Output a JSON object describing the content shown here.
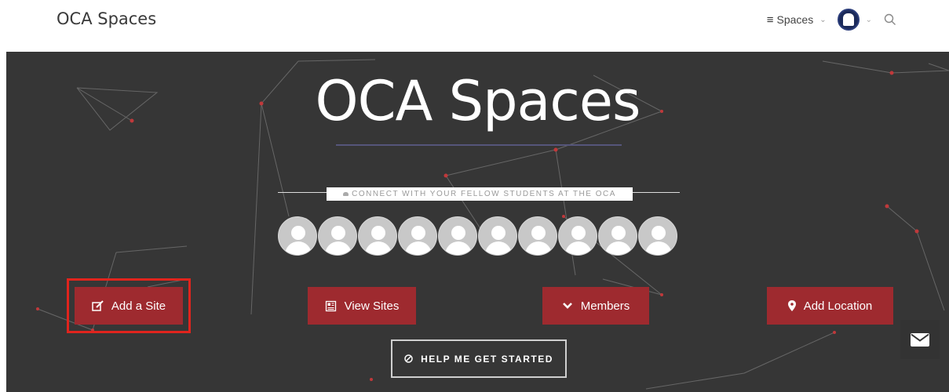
{
  "site": {
    "brand": "OCA Spaces"
  },
  "nav": {
    "spaces_label": "Spaces"
  },
  "hero": {
    "title": "OCA Spaces",
    "tagline": "CONNECT WITH YOUR FELLOW STUDENTS AT THE OCA",
    "member_count": 10
  },
  "actions": {
    "add_site": "Add a Site",
    "view_sites": "View Sites",
    "members": "Members",
    "add_location": "Add Location",
    "help": "HELP ME GET STARTED"
  },
  "colors": {
    "hero_bg": "#363636",
    "button_red": "#9e2a2f",
    "highlight": "#e0241d"
  },
  "icons": {
    "menu": "hamburger-icon",
    "search": "search-icon",
    "add_site": "edit-icon",
    "view_sites": "newspaper-icon",
    "members": "chevron-down-icon",
    "add_location": "map-pin-icon",
    "help": "compass-icon",
    "contact": "envelope-icon"
  }
}
